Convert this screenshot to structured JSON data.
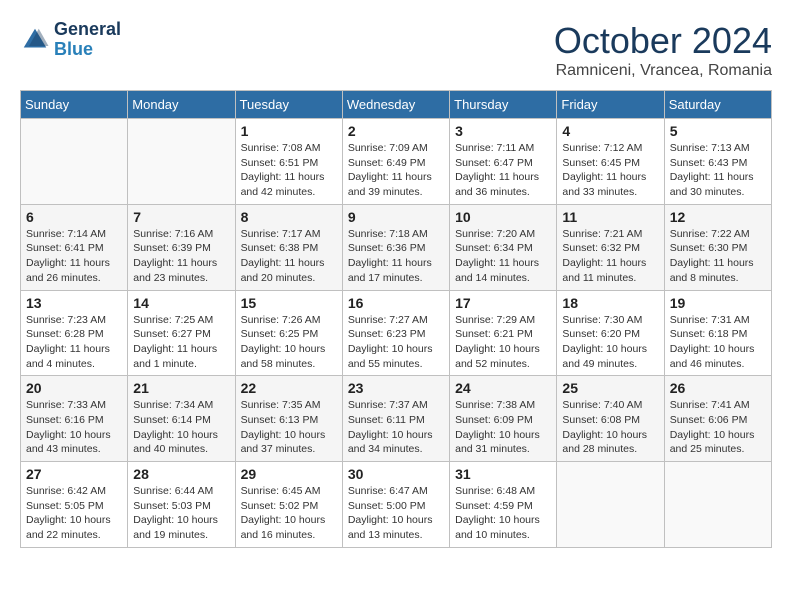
{
  "header": {
    "logo": {
      "line1": "General",
      "line2": "Blue"
    },
    "title": "October 2024",
    "subtitle": "Ramniceni, Vrancea, Romania"
  },
  "weekdays": [
    "Sunday",
    "Monday",
    "Tuesday",
    "Wednesday",
    "Thursday",
    "Friday",
    "Saturday"
  ],
  "weeks": [
    [
      {
        "day": "",
        "info": ""
      },
      {
        "day": "",
        "info": ""
      },
      {
        "day": "1",
        "info": "Sunrise: 7:08 AM\nSunset: 6:51 PM\nDaylight: 11 hours and 42 minutes."
      },
      {
        "day": "2",
        "info": "Sunrise: 7:09 AM\nSunset: 6:49 PM\nDaylight: 11 hours and 39 minutes."
      },
      {
        "day": "3",
        "info": "Sunrise: 7:11 AM\nSunset: 6:47 PM\nDaylight: 11 hours and 36 minutes."
      },
      {
        "day": "4",
        "info": "Sunrise: 7:12 AM\nSunset: 6:45 PM\nDaylight: 11 hours and 33 minutes."
      },
      {
        "day": "5",
        "info": "Sunrise: 7:13 AM\nSunset: 6:43 PM\nDaylight: 11 hours and 30 minutes."
      }
    ],
    [
      {
        "day": "6",
        "info": "Sunrise: 7:14 AM\nSunset: 6:41 PM\nDaylight: 11 hours and 26 minutes."
      },
      {
        "day": "7",
        "info": "Sunrise: 7:16 AM\nSunset: 6:39 PM\nDaylight: 11 hours and 23 minutes."
      },
      {
        "day": "8",
        "info": "Sunrise: 7:17 AM\nSunset: 6:38 PM\nDaylight: 11 hours and 20 minutes."
      },
      {
        "day": "9",
        "info": "Sunrise: 7:18 AM\nSunset: 6:36 PM\nDaylight: 11 hours and 17 minutes."
      },
      {
        "day": "10",
        "info": "Sunrise: 7:20 AM\nSunset: 6:34 PM\nDaylight: 11 hours and 14 minutes."
      },
      {
        "day": "11",
        "info": "Sunrise: 7:21 AM\nSunset: 6:32 PM\nDaylight: 11 hours and 11 minutes."
      },
      {
        "day": "12",
        "info": "Sunrise: 7:22 AM\nSunset: 6:30 PM\nDaylight: 11 hours and 8 minutes."
      }
    ],
    [
      {
        "day": "13",
        "info": "Sunrise: 7:23 AM\nSunset: 6:28 PM\nDaylight: 11 hours and 4 minutes."
      },
      {
        "day": "14",
        "info": "Sunrise: 7:25 AM\nSunset: 6:27 PM\nDaylight: 11 hours and 1 minute."
      },
      {
        "day": "15",
        "info": "Sunrise: 7:26 AM\nSunset: 6:25 PM\nDaylight: 10 hours and 58 minutes."
      },
      {
        "day": "16",
        "info": "Sunrise: 7:27 AM\nSunset: 6:23 PM\nDaylight: 10 hours and 55 minutes."
      },
      {
        "day": "17",
        "info": "Sunrise: 7:29 AM\nSunset: 6:21 PM\nDaylight: 10 hours and 52 minutes."
      },
      {
        "day": "18",
        "info": "Sunrise: 7:30 AM\nSunset: 6:20 PM\nDaylight: 10 hours and 49 minutes."
      },
      {
        "day": "19",
        "info": "Sunrise: 7:31 AM\nSunset: 6:18 PM\nDaylight: 10 hours and 46 minutes."
      }
    ],
    [
      {
        "day": "20",
        "info": "Sunrise: 7:33 AM\nSunset: 6:16 PM\nDaylight: 10 hours and 43 minutes."
      },
      {
        "day": "21",
        "info": "Sunrise: 7:34 AM\nSunset: 6:14 PM\nDaylight: 10 hours and 40 minutes."
      },
      {
        "day": "22",
        "info": "Sunrise: 7:35 AM\nSunset: 6:13 PM\nDaylight: 10 hours and 37 minutes."
      },
      {
        "day": "23",
        "info": "Sunrise: 7:37 AM\nSunset: 6:11 PM\nDaylight: 10 hours and 34 minutes."
      },
      {
        "day": "24",
        "info": "Sunrise: 7:38 AM\nSunset: 6:09 PM\nDaylight: 10 hours and 31 minutes."
      },
      {
        "day": "25",
        "info": "Sunrise: 7:40 AM\nSunset: 6:08 PM\nDaylight: 10 hours and 28 minutes."
      },
      {
        "day": "26",
        "info": "Sunrise: 7:41 AM\nSunset: 6:06 PM\nDaylight: 10 hours and 25 minutes."
      }
    ],
    [
      {
        "day": "27",
        "info": "Sunrise: 6:42 AM\nSunset: 5:05 PM\nDaylight: 10 hours and 22 minutes."
      },
      {
        "day": "28",
        "info": "Sunrise: 6:44 AM\nSunset: 5:03 PM\nDaylight: 10 hours and 19 minutes."
      },
      {
        "day": "29",
        "info": "Sunrise: 6:45 AM\nSunset: 5:02 PM\nDaylight: 10 hours and 16 minutes."
      },
      {
        "day": "30",
        "info": "Sunrise: 6:47 AM\nSunset: 5:00 PM\nDaylight: 10 hours and 13 minutes."
      },
      {
        "day": "31",
        "info": "Sunrise: 6:48 AM\nSunset: 4:59 PM\nDaylight: 10 hours and 10 minutes."
      },
      {
        "day": "",
        "info": ""
      },
      {
        "day": "",
        "info": ""
      }
    ]
  ]
}
